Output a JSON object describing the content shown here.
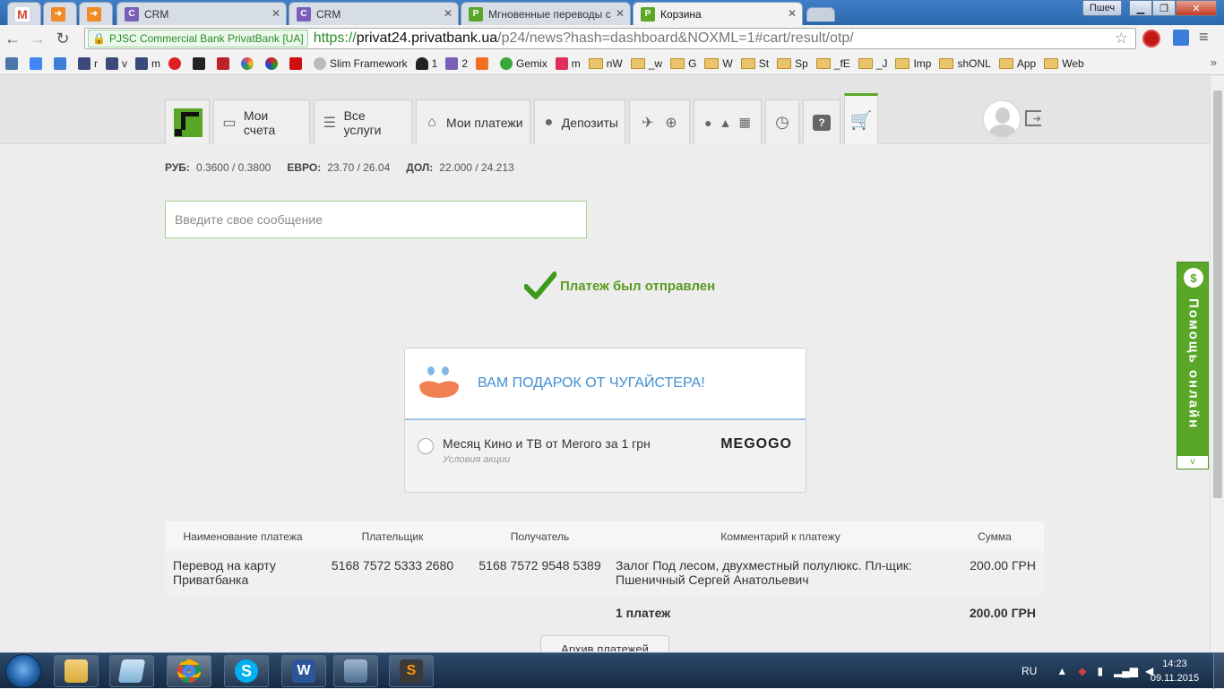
{
  "browser": {
    "tabs": [
      {
        "label": "",
        "icon": "gmail-icon",
        "color": "#d44638"
      },
      {
        "label": "",
        "icon": "arrow-icon",
        "color": "#f08a24"
      },
      {
        "label": "",
        "icon": "arrow-icon",
        "color": "#f08a24"
      },
      {
        "label": "CRM",
        "icon": "crm-icon",
        "color": "#7b5fb7"
      },
      {
        "label": "CRM",
        "icon": "crm-icon",
        "color": "#7b5fb7"
      },
      {
        "label": "Мгновенные переводы с",
        "icon": "privat-icon",
        "color": "#5aa627"
      },
      {
        "label": "Корзина",
        "icon": "privat-icon",
        "color": "#5aa627"
      }
    ],
    "user_chip": "Пшеч",
    "ev_label": "PJSC Commercial Bank PrivatBank [UA]",
    "url_scheme": "https://",
    "url_host": "privat24.privatbank.ua",
    "url_path": "/p24/news?hash=dashboard&NOXML=1#cart/result/otp/",
    "bookmarks": [
      {
        "label": "",
        "icon": "vk-icon",
        "color": "#4a76a8"
      },
      {
        "label": "",
        "icon": "translate-icon",
        "color": "#4285f4"
      },
      {
        "label": "",
        "icon": "download-icon",
        "color": "#3b7dd8"
      },
      {
        "label": "r",
        "icon": "img-icon",
        "color": "#3a4a7a"
      },
      {
        "label": "v",
        "icon": "img-icon",
        "color": "#3a4a7a"
      },
      {
        "label": "m",
        "icon": "img-icon",
        "color": "#3a4a7a"
      },
      {
        "label": "",
        "icon": "heart-icon",
        "color": "#e02020"
      },
      {
        "label": "",
        "icon": "stm-icon",
        "color": "#222222"
      },
      {
        "label": "",
        "icon": "bars-icon",
        "color": "#c0202a"
      },
      {
        "label": "",
        "icon": "color-icon",
        "color": "#e84d4d"
      },
      {
        "label": "",
        "icon": "rgb-icon",
        "color": "#30a030"
      },
      {
        "label": "",
        "icon": "star-icon",
        "color": "#d01010"
      },
      {
        "label": "Slim Framework",
        "icon": "slim-icon",
        "color": "#bbbbbb"
      },
      {
        "label": "1",
        "icon": "person-icon",
        "color": "#222222"
      },
      {
        "label": "2",
        "icon": "crm-icon",
        "color": "#7b5fb7"
      },
      {
        "label": "",
        "icon": "orange-icon",
        "color": "#f07020"
      },
      {
        "label": "Gemix",
        "icon": "gemix-icon",
        "color": "#3aa63a"
      },
      {
        "label": "m",
        "icon": "wave-icon",
        "color": "#e0305a"
      }
    ],
    "bookmark_folders": [
      "nW",
      "_w",
      "G",
      "W",
      "St",
      "Sp",
      "_fE",
      "_J",
      "Imp",
      "shONL",
      "App",
      "Web"
    ]
  },
  "site": {
    "menu": {
      "my_accounts": "Мои счета",
      "all_services": "Все услуги",
      "my_payments": "Мои платежи",
      "deposits": "Депозиты"
    },
    "rates": [
      {
        "label": "РУБ:",
        "value": "0.3600 / 0.3800"
      },
      {
        "label": "ЕВРО:",
        "value": "23.70 / 26.04"
      },
      {
        "label": "ДОЛ:",
        "value": "22.000 / 24.213"
      }
    ],
    "message_placeholder": "Введите свое сообщение",
    "status": "Платеж был отправлен",
    "gift": {
      "title": "ВАМ ПОДАРОК ОТ ЧУГАЙСТЕРА!",
      "offer": "Месяц Кино и ТВ от Мегого за 1 грн",
      "conditions": "Условия акции",
      "brand": "MEGOGO"
    },
    "table": {
      "headers": [
        "Наименование платежа",
        "Плательщик",
        "Получатель",
        "Комментарий к платежу",
        "Сумма"
      ],
      "rows": [
        [
          "Перевод на карту Приватбанка",
          "5168 7572 5333 2680",
          "5168 7572 9548 5389",
          "Залог Под лесом, двухместный полулюкс. Пл-щик: Пшеничный Сергей Анатольевич",
          "200.00 ГРН"
        ]
      ],
      "total_count": "1 платеж",
      "total_sum": "200.00 ГРН"
    },
    "archive_button": "Архив платежей",
    "help_label": "Помощь онлайн",
    "accent": "#5aa627"
  },
  "taskbar": {
    "lang": "RU",
    "time": "14:23",
    "date": "09.11.2015",
    "apps": [
      "explorer-icon",
      "notepad-icon",
      "chrome-icon",
      "skype-icon",
      "word-icon",
      "network-icon",
      "sublime-icon"
    ]
  }
}
